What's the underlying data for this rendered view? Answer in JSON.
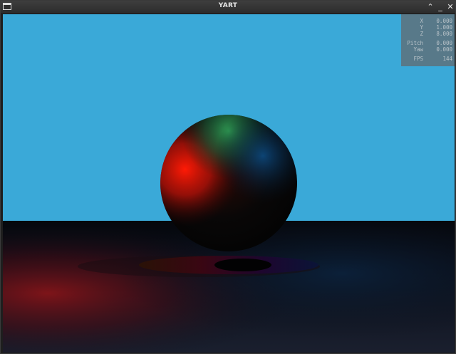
{
  "window": {
    "title": "YART",
    "controls": {
      "maximize_icon": "chevron-up",
      "minimize_icon": "underscore",
      "close_icon": "x-mark"
    }
  },
  "hud": {
    "rows": [
      {
        "label": "X",
        "value": "0.000"
      },
      {
        "label": "Y",
        "value": "1.000"
      },
      {
        "label": "Z",
        "value": "8.000"
      },
      {
        "label": "Pitch",
        "value": "0.000"
      },
      {
        "label": "Yaw",
        "value": "0.000"
      },
      {
        "label": "FPS",
        "value": "144"
      }
    ]
  },
  "scene": {
    "sky_color": "#3aa9d8",
    "floor_color": "#0d111c",
    "sphere_light_colors": [
      "#e01606",
      "#1c7a3e",
      "#0c3a6b"
    ]
  }
}
